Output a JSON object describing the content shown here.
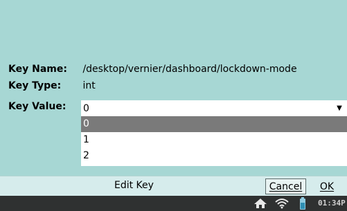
{
  "details": {
    "key_name_label": "Key Name:",
    "key_name_value": "/desktop/vernier/dashboard/lockdown-mode",
    "key_type_label": "Key Type:",
    "key_type_value": "int",
    "key_value_label": "Key Value:"
  },
  "key_value_select": {
    "selected": "0",
    "options": [
      "0",
      "1",
      "2"
    ],
    "highlighted_option": "0"
  },
  "bottom_bar": {
    "title": "Edit Key",
    "cancel_label": "Cancel",
    "ok_label": "OK"
  },
  "status_bar": {
    "clock": "01:34P",
    "icons": [
      "home-icon",
      "wifi-icon",
      "battery-icon"
    ]
  },
  "colors": {
    "background": "#a7d7d4",
    "bottom_bar": "#d6ecec",
    "status_bar": "#2f3131",
    "highlight": "#7a7a7a"
  }
}
